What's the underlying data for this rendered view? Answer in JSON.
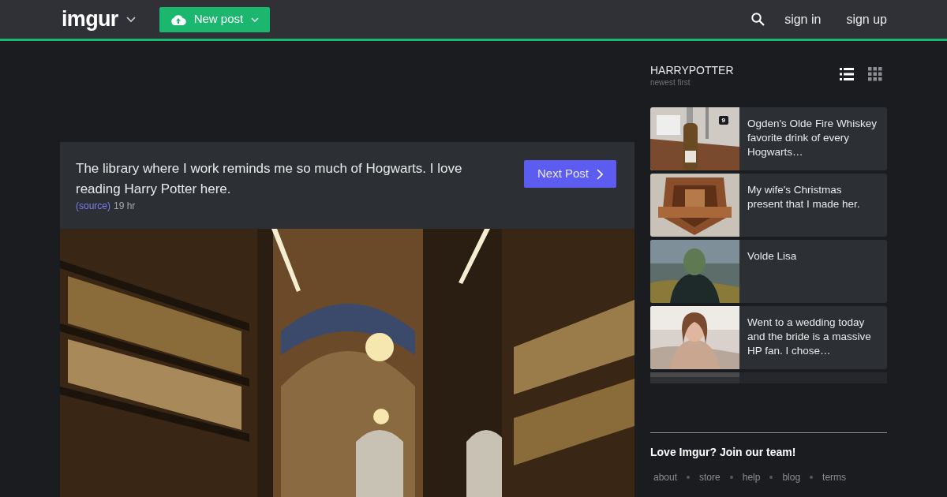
{
  "topbar": {
    "logo": "imgur",
    "new_post": "New post",
    "sign_in": "sign in",
    "sign_up": "sign up"
  },
  "post": {
    "title": "The library where I work reminds me so much of Hogwarts. I love reading Harry Potter here.",
    "source": "(source)",
    "time": "19 hr",
    "next": "Next Post"
  },
  "sidebar": {
    "tag": "HARRYPOTTER",
    "sort": "newest first",
    "views": [
      {
        "kind": "list",
        "selected": true
      },
      {
        "kind": "grid",
        "selected": false
      }
    ],
    "items": [
      {
        "title": "Ogden's Olde Fire Whiskey favorite drink of every Hogwarts…",
        "count": "9"
      },
      {
        "title": "My wife's Christmas present that I made her."
      },
      {
        "title": "Volde Lisa"
      },
      {
        "title": "Went to a wedding today and the bride is a massive HP fan. I chose…"
      }
    ],
    "promo": "Love Imgur? Join our team!",
    "links": [
      "about",
      "store",
      "help",
      "blog",
      "terms"
    ]
  }
}
